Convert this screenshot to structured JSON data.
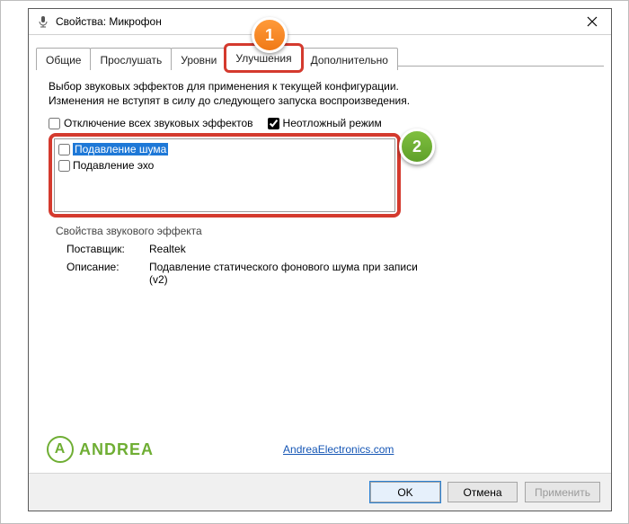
{
  "window": {
    "title": "Свойства: Микрофон"
  },
  "tabs": {
    "general": "Общие",
    "listen": "Прослушать",
    "levels": "Уровни",
    "enhancements": "Улучшения",
    "advanced": "Дополнительно"
  },
  "markers": {
    "one": "1",
    "two": "2"
  },
  "panel": {
    "description": "Выбор звуковых эффектов для применения к текущей конфигурации. Изменения не вступят в силу до следующего запуска воспроизведения.",
    "disable_all": "Отключение всех звуковых эффектов",
    "immediate": "Неотложный режим",
    "effects": {
      "noise": "Подавление шума",
      "echo": "Подавление эхо"
    },
    "group_label": "Свойства звукового эффекта",
    "provider_k": "Поставщик:",
    "provider_v": "Realtek",
    "desc_k": "Описание:",
    "desc_v": "Подавление статического фонового шума при записи (v2)"
  },
  "logo": {
    "brand": "ANDREA",
    "letter": "A",
    "link": "AndreaElectronics.com"
  },
  "footer": {
    "ok": "OK",
    "cancel": "Отмена",
    "apply": "Применить"
  }
}
